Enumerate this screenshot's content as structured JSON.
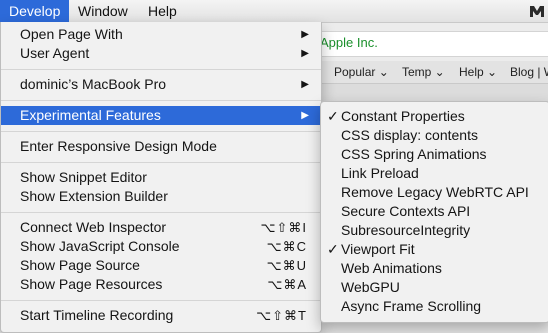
{
  "menubar": {
    "items": [
      "Develop",
      "Window",
      "Help"
    ],
    "active_index": 0
  },
  "browser": {
    "address_text": "Apple Inc.",
    "bookmarks": [
      "Popular",
      "Temp",
      "Help",
      "Blog | W"
    ]
  },
  "develop_menu": {
    "items": [
      {
        "label": "Open Page With",
        "submenu": true
      },
      {
        "label": "User Agent",
        "submenu": true
      },
      {
        "label": "dominic’s MacBook Pro",
        "submenu": true
      },
      {
        "label": "Experimental Features",
        "submenu": true,
        "highlighted": true
      },
      {
        "label": "Enter Responsive Design Mode"
      },
      {
        "label": "Show Snippet Editor"
      },
      {
        "label": "Show Extension Builder"
      },
      {
        "label": "Connect Web Inspector",
        "shortcut": "⌥⇧⌘I"
      },
      {
        "label": "Show JavaScript Console",
        "shortcut": "⌥⌘C"
      },
      {
        "label": "Show Page Source",
        "shortcut": "⌥⌘U"
      },
      {
        "label": "Show Page Resources",
        "shortcut": "⌥⌘A"
      },
      {
        "label": "Start Timeline Recording",
        "shortcut": "⌥⇧⌘T"
      }
    ]
  },
  "experimental_features": {
    "items": [
      {
        "label": "Constant Properties",
        "checked": true
      },
      {
        "label": "CSS display: contents",
        "checked": false
      },
      {
        "label": "CSS Spring Animations",
        "checked": false
      },
      {
        "label": "Link Preload",
        "checked": false
      },
      {
        "label": "Remove Legacy WebRTC API",
        "checked": false
      },
      {
        "label": "Secure Contexts API",
        "checked": false
      },
      {
        "label": "SubresourceIntegrity",
        "checked": false
      },
      {
        "label": "Viewport Fit",
        "checked": true
      },
      {
        "label": "Web Animations",
        "checked": false
      },
      {
        "label": "WebGPU",
        "checked": false
      },
      {
        "label": "Async Frame Scrolling",
        "checked": false
      }
    ],
    "check_glyph": "✓"
  },
  "colors": {
    "highlight": "#2d6ad9",
    "address_green": "#1a8f2b"
  }
}
